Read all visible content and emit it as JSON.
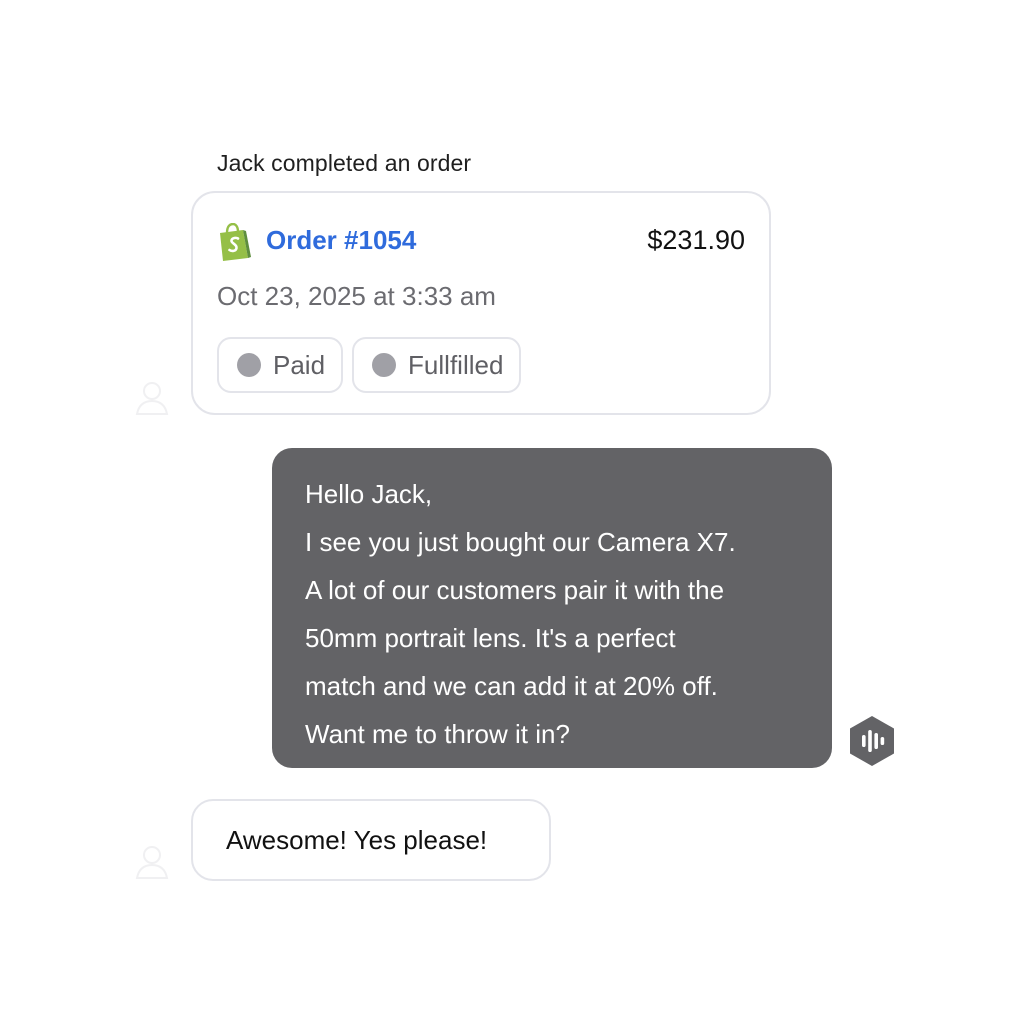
{
  "event": {
    "label": "Jack completed an order"
  },
  "order": {
    "store_icon": "shopify-bag-icon",
    "id": "Order #1054",
    "total": "$231.90",
    "date": "Oct 23, 2025 at 3:33 am",
    "badges": [
      {
        "label": "Paid"
      },
      {
        "label": "Fullfilled"
      }
    ]
  },
  "agent_message": {
    "lines": [
      "Hello Jack,",
      "I see you just bought our Camera X7.",
      "A lot of our customers pair it with the",
      "50mm portrait lens. It's a perfect",
      "match and we can add it at 20% off.",
      "Want me to throw it in?"
    ],
    "icon": "voice-waveform-icon"
  },
  "user_message": {
    "text": "Awesome! Yes please!"
  },
  "colors": {
    "link_blue": "#2f6bdc",
    "agent_bubble": "#636366",
    "border": "#e3e4ea",
    "badge_dot": "#a0a0a6",
    "shopify_green": "#95bf47"
  }
}
